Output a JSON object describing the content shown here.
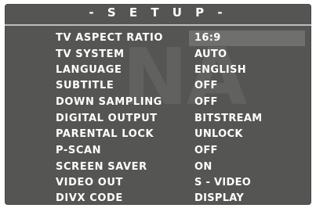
{
  "menu": {
    "title": "- S E T U P -",
    "items": [
      {
        "label": "TV ASPECT RATIO",
        "value": "16:9"
      },
      {
        "label": "TV SYSTEM",
        "value": "AUTO"
      },
      {
        "label": "LANGUAGE",
        "value": "ENGLISH"
      },
      {
        "label": "SUBTITLE",
        "value": "OFF"
      },
      {
        "label": "DOWN SAMPLING",
        "value": "OFF"
      },
      {
        "label": "DIGITAL OUTPUT",
        "value": "BITSTREAM"
      },
      {
        "label": "PARENTAL LOCK",
        "value": "UNLOCK"
      },
      {
        "label": "P-SCAN",
        "value": "OFF"
      },
      {
        "label": "SCREEN SAVER",
        "value": "ON"
      },
      {
        "label": "VIDEO OUT",
        "value": "S - VIDEO"
      },
      {
        "label": "DIVX CODE",
        "value": "DISPLAY"
      }
    ],
    "selected_index": 0
  },
  "colors": {
    "background": "#555654",
    "highlight": "#6f706e",
    "text": "#ffffff"
  }
}
